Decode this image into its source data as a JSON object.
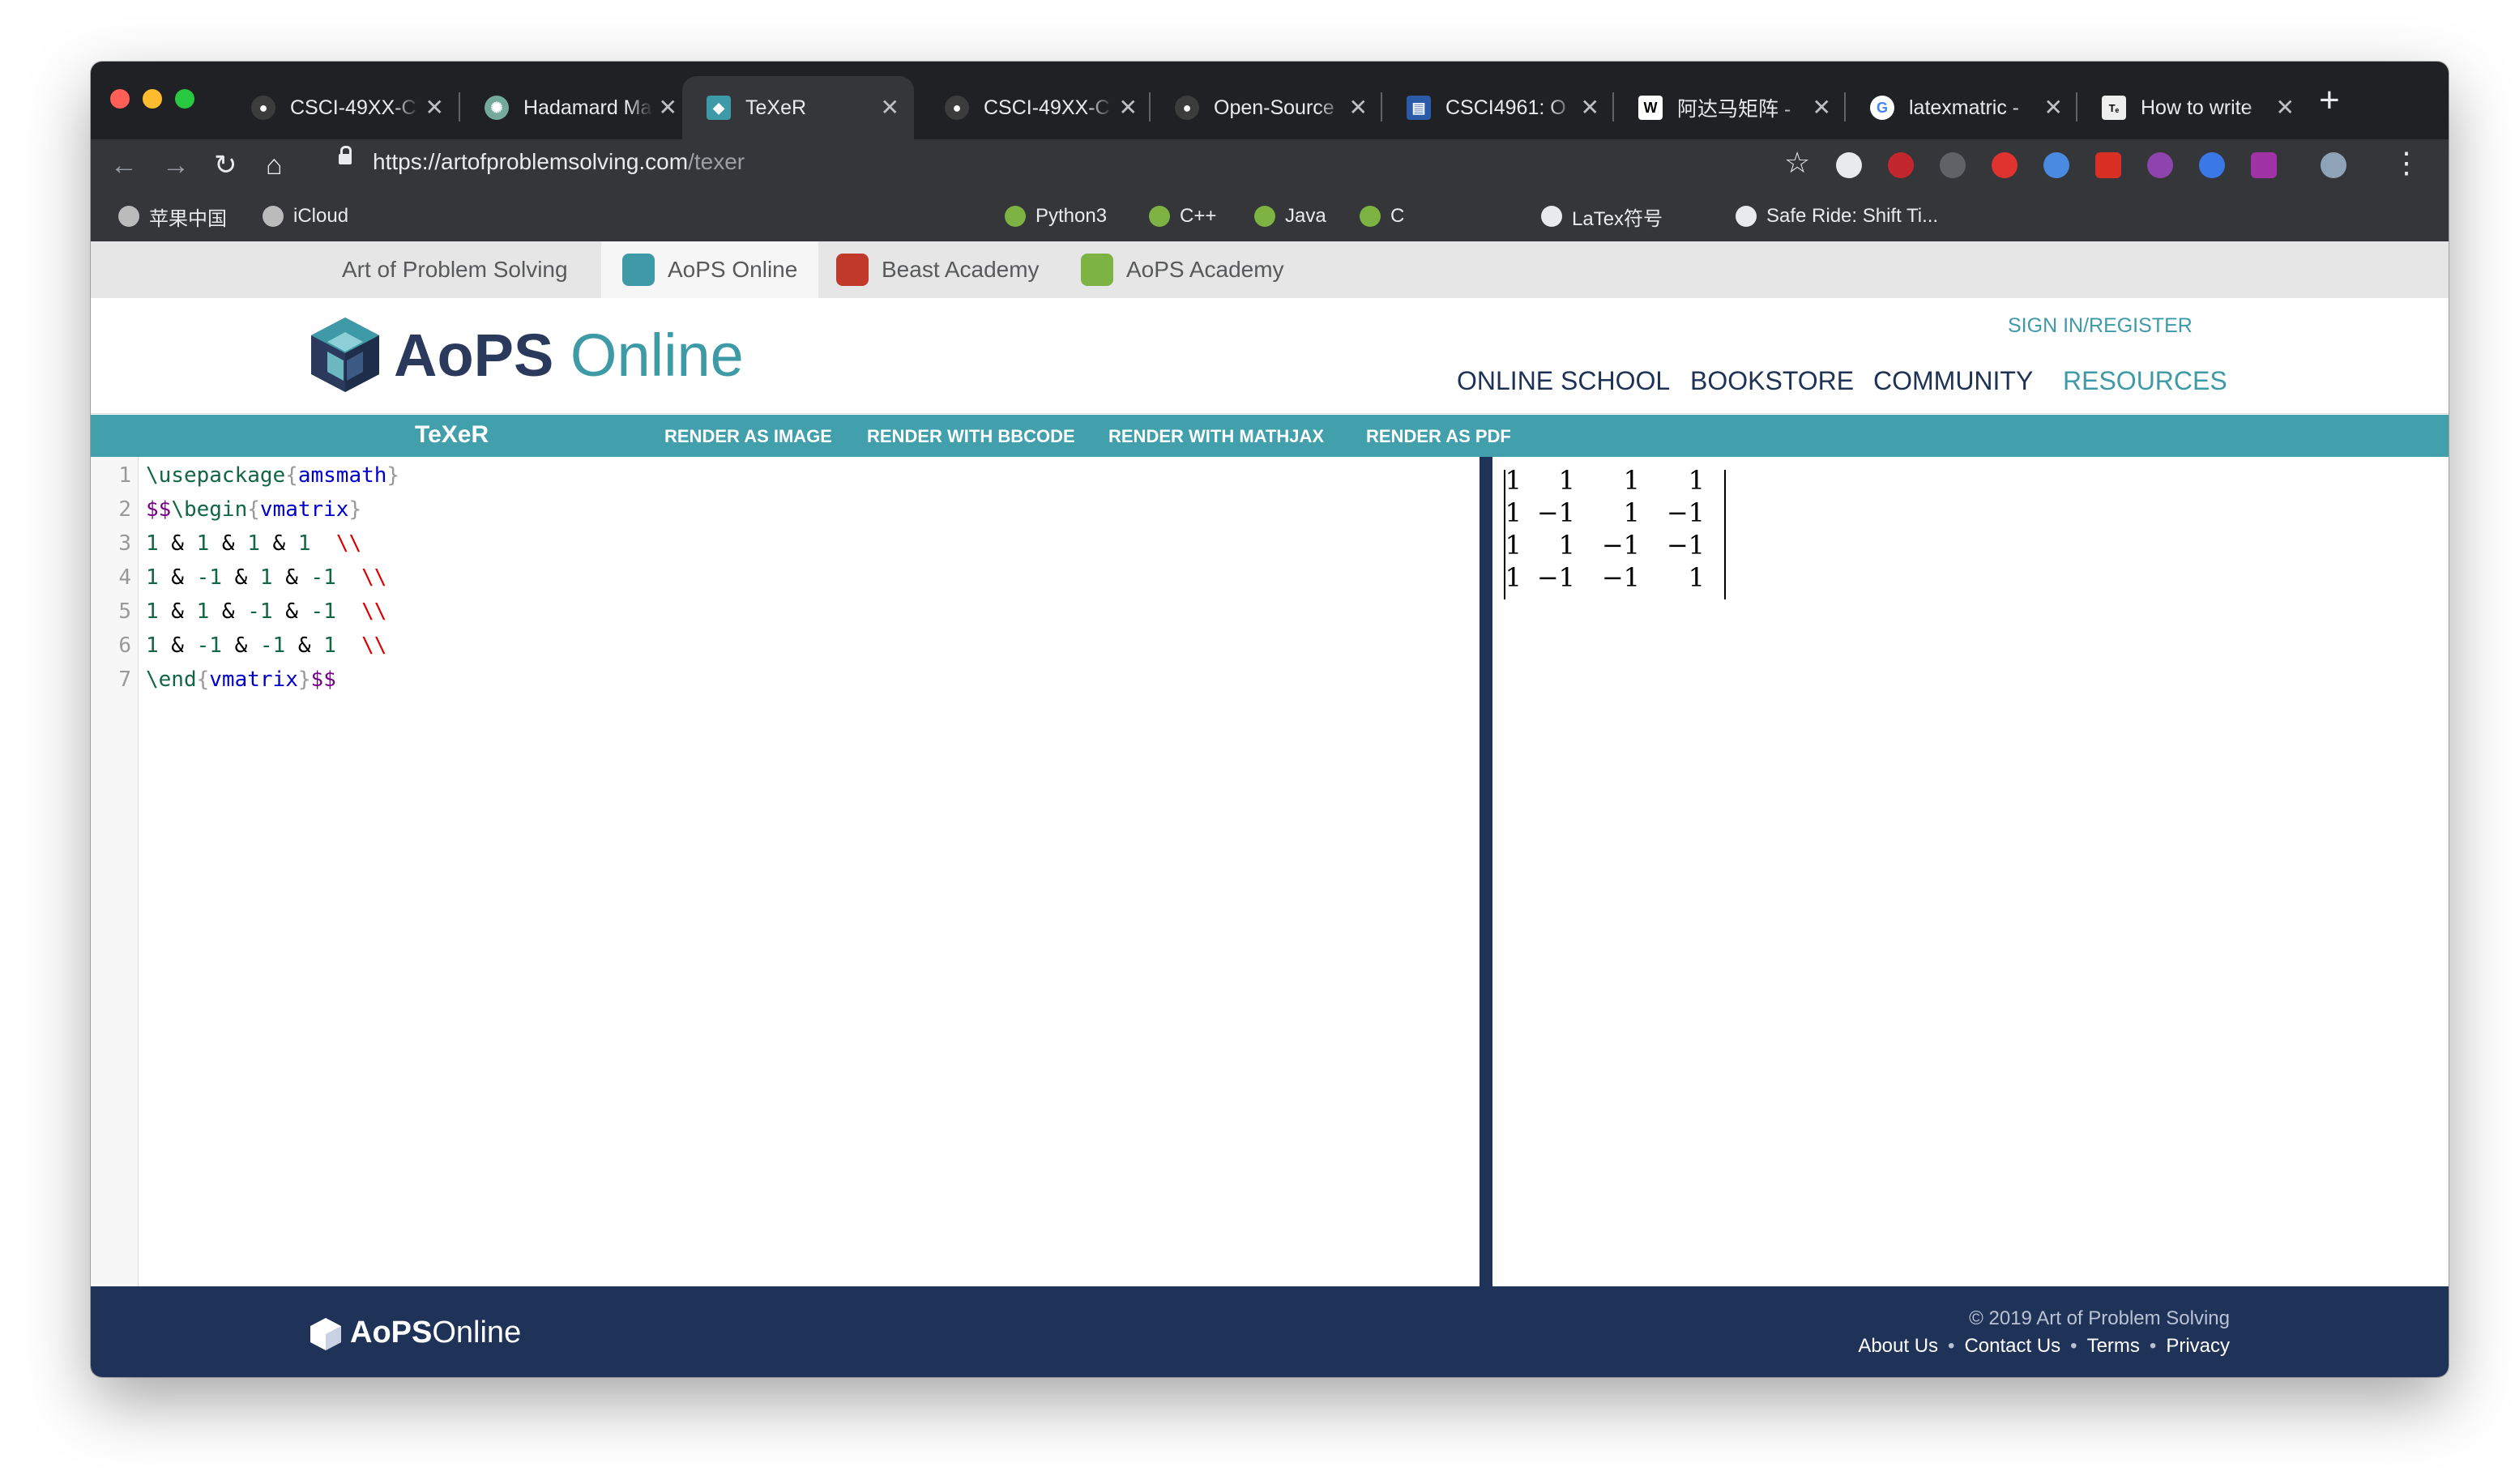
{
  "browser": {
    "tabs": [
      {
        "title": "CSCI-49XX-C",
        "icon": "github-icon",
        "active": false
      },
      {
        "title": "Hadamard Ma",
        "icon": "openai-icon",
        "active": false
      },
      {
        "title": "TeXeR",
        "icon": "aops-icon",
        "active": true
      },
      {
        "title": "CSCI-49XX-C",
        "icon": "github-icon",
        "active": false
      },
      {
        "title": "Open-Source",
        "icon": "github-icon",
        "active": false
      },
      {
        "title": "CSCI4961: O",
        "icon": "course-icon",
        "active": false
      },
      {
        "title": "阿达马矩阵 -",
        "icon": "wikipedia-icon",
        "active": false
      },
      {
        "title": "latexmatric -",
        "icon": "google-icon",
        "active": false
      },
      {
        "title": "How to write",
        "icon": "latex-icon",
        "active": false
      }
    ],
    "url_main": "https://artofproblemsolving.com",
    "url_path": "/texer",
    "bookmarks": [
      "苹果中国",
      "iCloud",
      "Python3",
      "C++",
      "Java",
      "C",
      "LaTex符号",
      "Safe Ride: Shift Ti..."
    ]
  },
  "site_tabs": [
    "Art of Problem Solving",
    "AoPS Online",
    "Beast Academy",
    "AoPS Academy"
  ],
  "header": {
    "logo_bold": "AoPS",
    "logo_light": "Online",
    "signin": "SIGN IN/REGISTER",
    "nav": [
      "ONLINE SCHOOL",
      "BOOKSTORE",
      "COMMUNITY",
      "RESOURCES"
    ]
  },
  "texer_bar": {
    "brand": "TeXeR",
    "actions": [
      "RENDER AS IMAGE",
      "RENDER WITH BBCODE",
      "RENDER WITH MATHJAX",
      "RENDER AS PDF"
    ]
  },
  "editor": {
    "line_numbers": [
      "1",
      "2",
      "3",
      "4",
      "5",
      "6",
      "7"
    ],
    "lines": [
      "\\usepackage{amsmath}",
      "$$\\begin{vmatrix}",
      "1 & 1 & 1 & 1  \\\\",
      "1 & -1 & 1 & -1  \\\\",
      "1 & 1 & -1 & -1  \\\\",
      "1 & -1 & -1 & 1  \\\\",
      "\\end{vmatrix}$$"
    ]
  },
  "output": {
    "matrix": [
      [
        "1",
        "1",
        "1",
        "1"
      ],
      [
        "1",
        "−1",
        "1",
        "−1"
      ],
      [
        "1",
        "1",
        "−1",
        "−1"
      ],
      [
        "1",
        "−1",
        "−1",
        "1"
      ]
    ]
  },
  "footer": {
    "logo_bold": "AoPS",
    "logo_light": "Online",
    "copyright": "© 2019 Art of Problem Solving",
    "links": [
      "About Us",
      "Contact Us",
      "Terms",
      "Privacy"
    ]
  },
  "colors": {
    "teal": "#41a0ac",
    "navy": "#1f3359",
    "chrome_dark": "#202124",
    "chrome_toolbar": "#35363a"
  }
}
